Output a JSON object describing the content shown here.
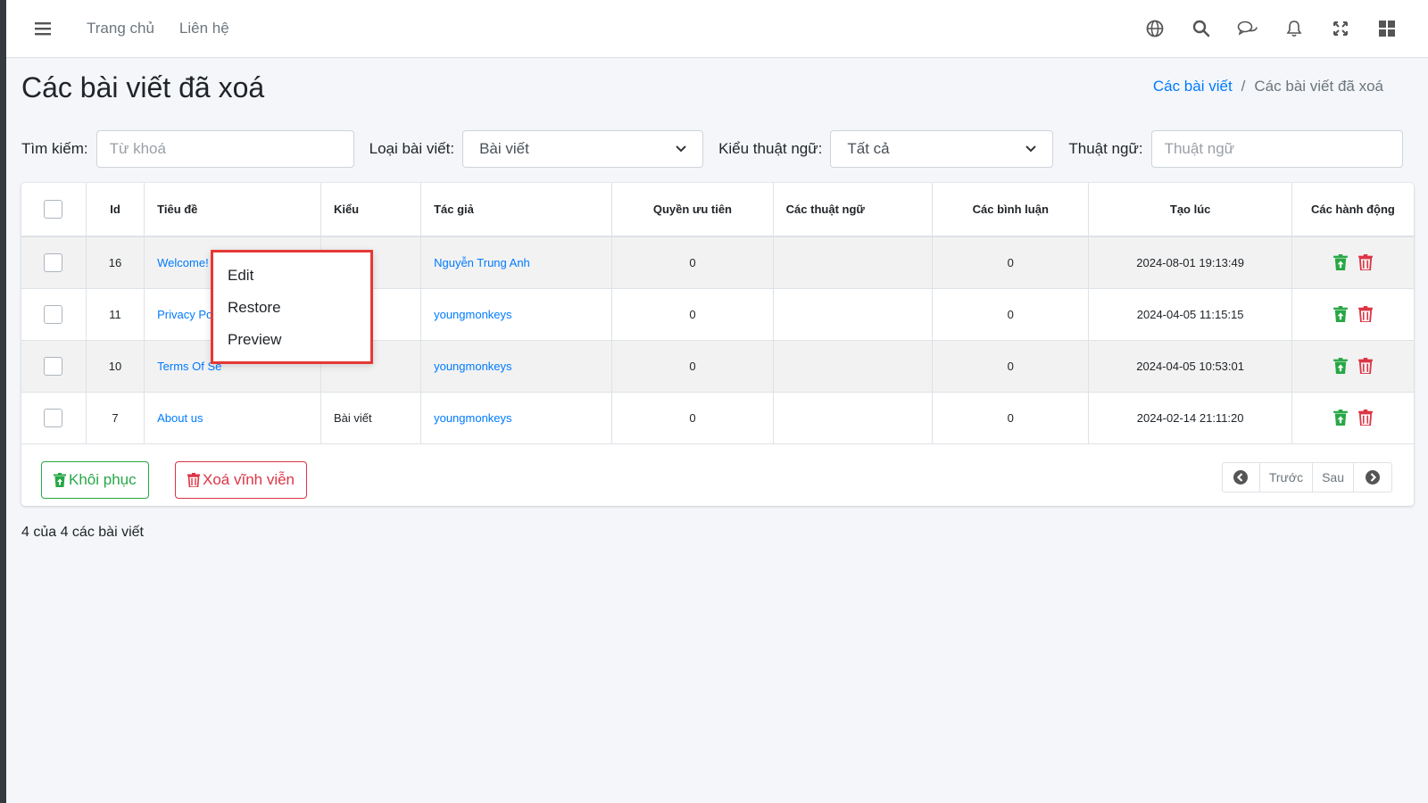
{
  "colors": {
    "accent": "#007bff",
    "success": "#28a745",
    "danger": "#dc3545",
    "menu_border": "#e53935"
  },
  "navbar": {
    "links": [
      "Trang chủ",
      "Liên hệ"
    ],
    "icons": [
      "globe-icon",
      "search-icon",
      "comments-icon",
      "bell-icon",
      "fullscreen-icon",
      "grid-icon"
    ]
  },
  "header": {
    "title": "Các bài viết đã xoá",
    "breadcrumb": {
      "link": "Các bài viết",
      "separator": "/",
      "current": "Các bài viết đã xoá"
    }
  },
  "filters": {
    "search_label": "Tìm kiếm:",
    "search_placeholder": "Từ khoá",
    "type_label": "Loại bài viết:",
    "type_value": "Bài viết",
    "term_type_label": "Kiểu thuật ngữ:",
    "term_type_value": "Tất cả",
    "term_label": "Thuật ngữ:",
    "term_placeholder": "Thuật ngữ"
  },
  "table": {
    "columns": [
      "Id",
      "Tiêu đề",
      "Kiểu",
      "Tác giả",
      "Quyền ưu tiên",
      "Các thuật ngữ",
      "Các bình luận",
      "Tạo lúc",
      "Các hành động"
    ],
    "rows": [
      {
        "id": "16",
        "title": "Welcome!",
        "type": "",
        "author": "Nguyễn Trung Anh",
        "priority": "0",
        "terms": "",
        "comments": "0",
        "created": "2024-08-01 19:13:49"
      },
      {
        "id": "11",
        "title": "Privacy Po",
        "type": "",
        "author": "youngmonkeys",
        "priority": "0",
        "terms": "",
        "comments": "0",
        "created": "2024-04-05 11:15:15"
      },
      {
        "id": "10",
        "title": "Terms Of Se",
        "type": "",
        "author": "youngmonkeys",
        "priority": "0",
        "terms": "",
        "comments": "0",
        "created": "2024-04-05 10:53:01"
      },
      {
        "id": "7",
        "title": "About us",
        "type": "Bài viết",
        "author": "youngmonkeys",
        "priority": "0",
        "terms": "",
        "comments": "0",
        "created": "2024-02-14 21:11:20"
      }
    ]
  },
  "footer": {
    "restore_label": "Khôi phục",
    "delete_label": "Xoá vĩnh viễn",
    "prev_label": "Trước",
    "next_label": "Sau"
  },
  "summary": "4 của 4 các bài viết",
  "context_menu": {
    "items": [
      "Edit",
      "Restore",
      "Preview"
    ]
  }
}
